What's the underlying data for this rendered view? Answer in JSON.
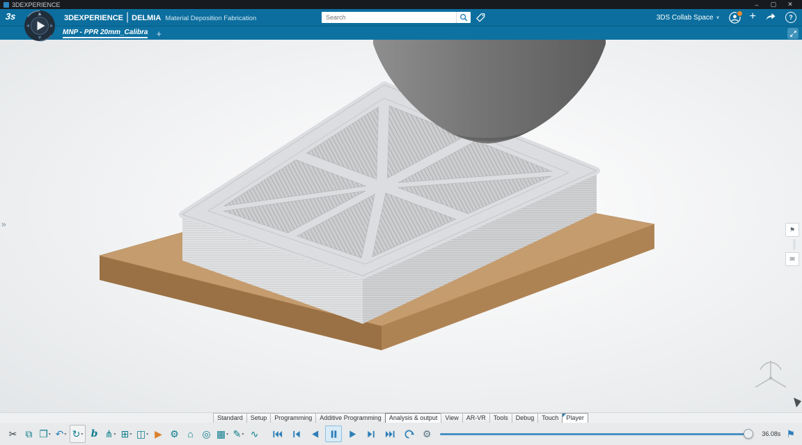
{
  "window": {
    "title": "3DEXPERIENCE",
    "minimize_glyph": "–",
    "maximize_glyph": "▢",
    "close_glyph": "✕"
  },
  "appbar": {
    "logo_text": "3s",
    "brand": "3DEXPERIENCE",
    "brand_sep": "|",
    "app_name": "DELMIA",
    "app_subtitle": "Material Deposition Fabrication",
    "search_placeholder": "Search",
    "collab_label": "3DS Collab Space",
    "collab_chevron": "∨",
    "plus_glyph": "+",
    "help_glyph": "?"
  },
  "tabbar": {
    "tab_title": "MNP - PPR 20mm_Calibra",
    "add_glyph": "+"
  },
  "viewport": {
    "expand_glyph": "»",
    "side_buttons": [
      {
        "name": "bookmark",
        "glyph": "⚑"
      },
      {
        "name": "message",
        "glyph": "✉"
      }
    ]
  },
  "ribbon": {
    "tabs": [
      {
        "label": "Standard"
      },
      {
        "label": "Setup"
      },
      {
        "label": "Programming"
      },
      {
        "label": "Additive Programming"
      },
      {
        "label": "Analysis & output",
        "highlight": true
      },
      {
        "label": "View"
      },
      {
        "label": "AR-VR"
      },
      {
        "label": "Tools"
      },
      {
        "label": "Debug"
      },
      {
        "label": "Touch"
      },
      {
        "label": "Player",
        "active": true
      }
    ]
  },
  "toolbar": {
    "caret_glyph": "▾",
    "tools": [
      {
        "name": "cut",
        "glyph": "✂",
        "color": "#3a4046"
      },
      {
        "name": "copy",
        "glyph": "⧉",
        "color": "#0f7e8f"
      },
      {
        "name": "paste",
        "glyph": "❐",
        "color": "#0f7e8f",
        "caret": true
      },
      {
        "name": "undo",
        "glyph": "↶",
        "color": "#2e7fb8",
        "caret": true
      },
      {
        "name": "update",
        "glyph": "↻",
        "color": "#0f7e8f",
        "caret": true,
        "boxed": true
      },
      {
        "name": "behavior",
        "glyph": "b",
        "color": "#0f7e8f"
      },
      {
        "name": "process-tree",
        "glyph": "⋔",
        "color": "#0f7e8f",
        "caret": true
      },
      {
        "name": "window-layout",
        "glyph": "⊞",
        "color": "#0f7e8f",
        "caret": true
      },
      {
        "name": "compare",
        "glyph": "◫",
        "color": "#0f7e8f",
        "caret": true
      },
      {
        "name": "run-simulation",
        "glyph": "▶",
        "color": "#d9822b"
      },
      {
        "name": "machine-setup",
        "glyph": "⚙",
        "color": "#0f7e8f"
      },
      {
        "name": "home-position",
        "glyph": "⌂",
        "color": "#0f7e8f"
      },
      {
        "name": "probe-analysis",
        "glyph": "◎",
        "color": "#0f7e8f"
      },
      {
        "name": "output-table",
        "glyph": "▦",
        "color": "#0f7e8f",
        "caret": true
      },
      {
        "name": "edit-program",
        "glyph": "✎",
        "color": "#0f7e8f",
        "caret": true
      },
      {
        "name": "signal-flow",
        "glyph": "∿",
        "color": "#0f7e8f"
      }
    ],
    "playback": [
      {
        "name": "jump-to-start"
      },
      {
        "name": "step-backward"
      },
      {
        "name": "play-backward"
      },
      {
        "name": "pause",
        "active": true
      },
      {
        "name": "play-forward"
      },
      {
        "name": "step-forward"
      },
      {
        "name": "jump-to-end"
      },
      {
        "name": "loop"
      }
    ],
    "settings_glyph": "⚙",
    "time": "36.08s",
    "finish_flag_glyph": "⚑"
  },
  "colors": {
    "bar_blue": "#0b6e9e",
    "accent_blue": "#2e7fb8",
    "plate_brown": "#c59c6e",
    "part_gray": "#dcdde0"
  }
}
